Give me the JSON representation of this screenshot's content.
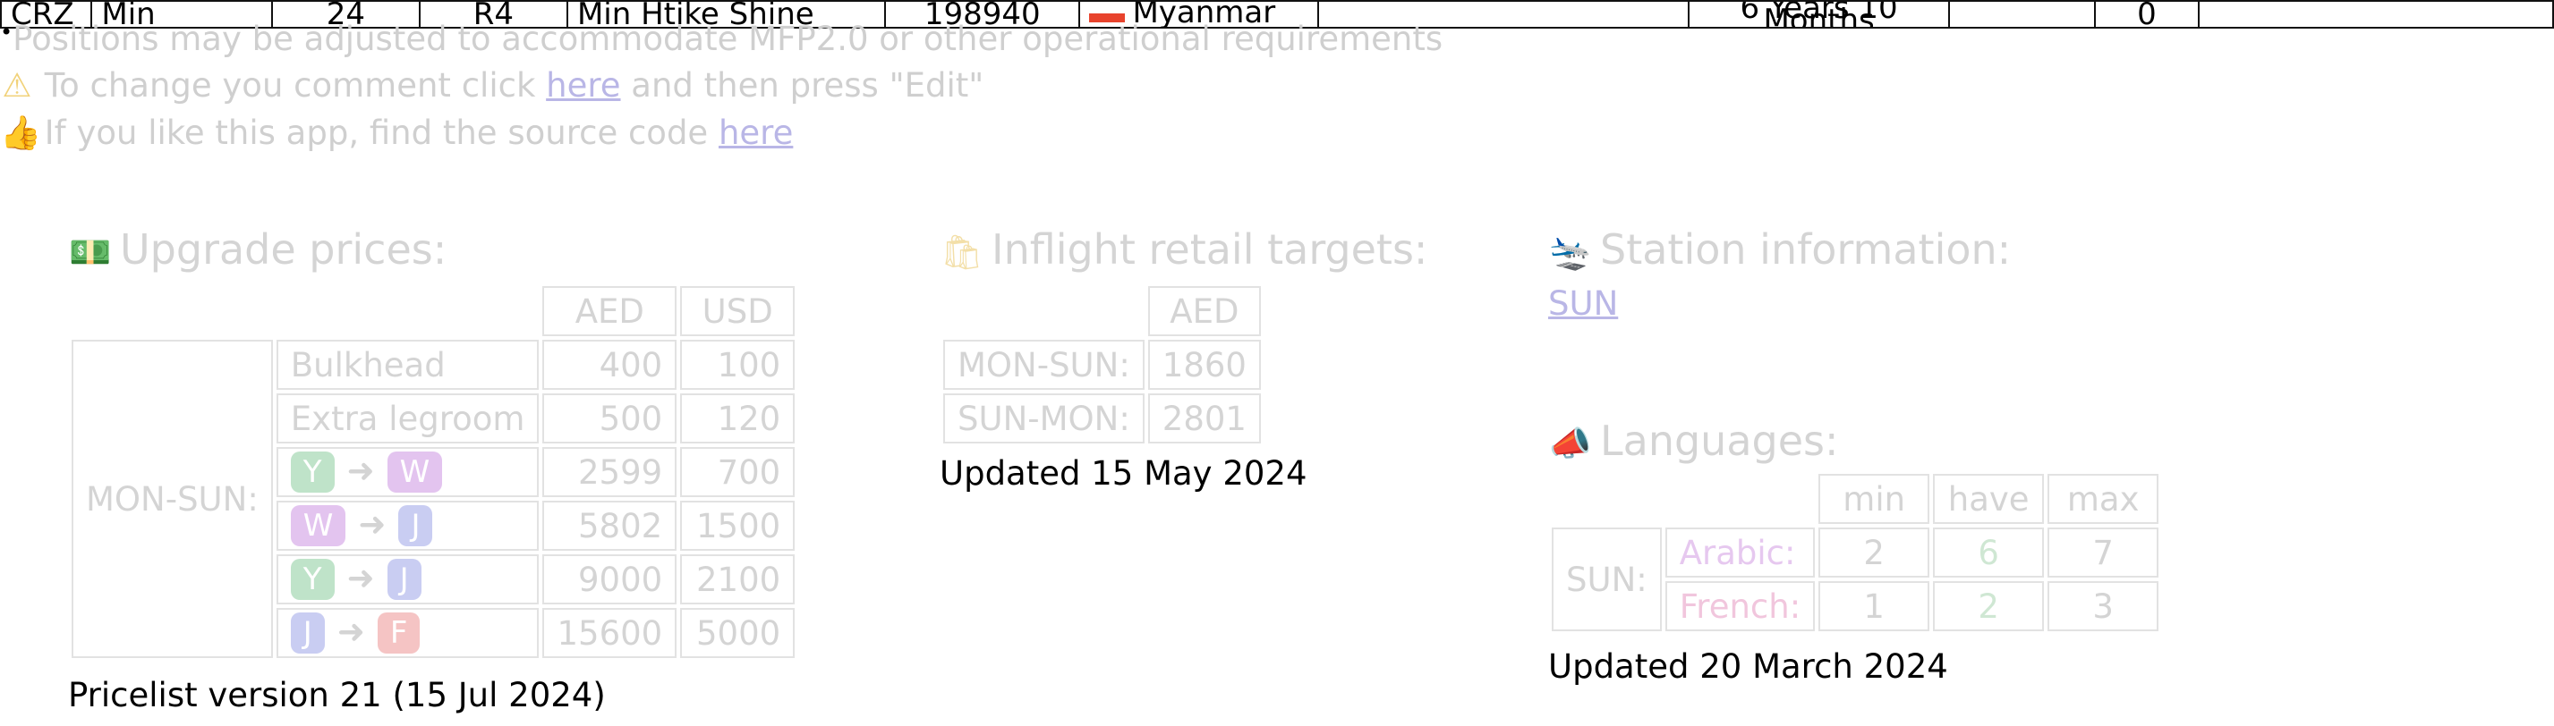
{
  "top_row": {
    "cells": [
      "CRZ",
      "Min",
      "24",
      "R4",
      "Min Htike Shine",
      "198940",
      "Myanmar",
      "",
      "6 Years 10 Months",
      "",
      "0",
      ""
    ],
    "colors": {
      "flag": "#e8432d"
    }
  },
  "notes": {
    "positions": "Positions may be adjusted to accommodate MFP2.0 or other operational requirements",
    "comment_prefix": "To change you comment click",
    "comment_link": "here",
    "comment_suffix": "and then press \"Edit\"",
    "source_prefix": "If you like this app, find the source code",
    "source_link": "here"
  },
  "upgrade": {
    "title": "Upgrade prices:",
    "icon": "money-icon",
    "currencies": [
      "AED",
      "USD"
    ],
    "route": "MON-SUN:",
    "rows": [
      {
        "label": "Bulkhead",
        "aed": "400",
        "usd": "100"
      },
      {
        "label": "Extra legroom",
        "aed": "500",
        "usd": "120"
      },
      {
        "from": "Y",
        "to": "W",
        "aed": "2599",
        "usd": "700"
      },
      {
        "from": "W",
        "to": "J",
        "aed": "5802",
        "usd": "1500"
      },
      {
        "from": "Y",
        "to": "J",
        "aed": "9000",
        "usd": "2100"
      },
      {
        "from": "J",
        "to": "F",
        "aed": "15600",
        "usd": "5000"
      }
    ],
    "caption": "Pricelist version 21 (15 Jul 2024)"
  },
  "retail": {
    "title": "Inflight retail targets:",
    "icon": "shopping-bag-icon",
    "currency": "AED",
    "rows": [
      {
        "route": "MON-SUN:",
        "value": "1860"
      },
      {
        "route": "SUN-MON:",
        "value": "2801"
      }
    ],
    "caption": "Updated 15 May 2024"
  },
  "station": {
    "title": "Station information:",
    "icon": "plane-landing-icon",
    "link": "SUN"
  },
  "languages": {
    "title": "Languages:",
    "icon": "megaphone-icon",
    "headers": [
      "min",
      "have",
      "max"
    ],
    "station": "SUN:",
    "rows": [
      {
        "lang": "Arabic:",
        "min": "2",
        "have": "6",
        "max": "7"
      },
      {
        "lang": "French:",
        "min": "1",
        "have": "2",
        "max": "3"
      }
    ],
    "caption": "Updated 20 March 2024"
  },
  "class_colors": {
    "Y": "#bfe3c9",
    "W": "#e3c4ef",
    "J": "#c9cdf2",
    "F": "#f5c4c4"
  }
}
